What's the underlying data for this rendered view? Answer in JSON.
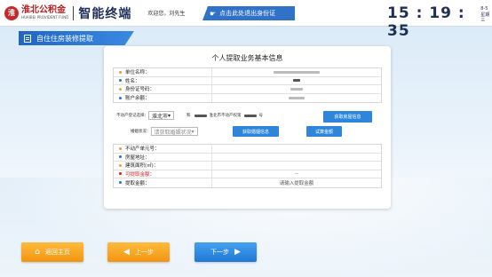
{
  "header": {
    "logo_mark": "淮",
    "logo_cn": "淮北公积金",
    "logo_en": "HUAIBEI PROVIDENT FUND",
    "title": "智能终端",
    "welcome": "欢迎您，刘先生",
    "notice": "点击此处退出身份证",
    "time": "15 : 19 : 35",
    "date": "8-5",
    "weekday": "星期三"
  },
  "section": {
    "title": "自住住房装修提取"
  },
  "panel": {
    "title": "个人提取业务基本信息",
    "top_rows": [
      {
        "label": "单位名称：",
        "bullet": "#f0a030"
      },
      {
        "label": "姓名：",
        "bullet": "#2a6fd0"
      },
      {
        "label": "身份证号码：",
        "bullet": "#f0a030"
      },
      {
        "label": "账户余额：",
        "bullet": "#2a6fd0"
      }
    ],
    "property_label": "不动产登记选择：",
    "city": "淮北市",
    "property_mid": "和",
    "property_hint": "淮北市不动产权第",
    "property_suffix": "号",
    "get_property_btn": "获取房屋信息",
    "marital_label": "婚姻状况：",
    "marital_value": "请获取婚姻状况",
    "get_marriage_btn": "获取婚姻信息",
    "calc_btn": "试算金额",
    "bottom_rows": [
      {
        "label": "不动产单元号：",
        "bullet": "#f0a030",
        "value": "",
        "red": false
      },
      {
        "label": "房屋地址：",
        "bullet": "#2a6fd0",
        "value": "",
        "red": false
      },
      {
        "label": "建筑面积(㎡)：",
        "bullet": "#f0a030",
        "value": "",
        "red": false
      },
      {
        "label": "可提取金额：",
        "bullet": "#d22222",
        "value": "--",
        "red": true
      },
      {
        "label": "提取金额：",
        "bullet": "#2a6fd0",
        "value": "请输入提取金额",
        "red": false
      }
    ]
  },
  "footer": {
    "home": "返回主页",
    "prev": "上一步",
    "next": "下一步"
  }
}
